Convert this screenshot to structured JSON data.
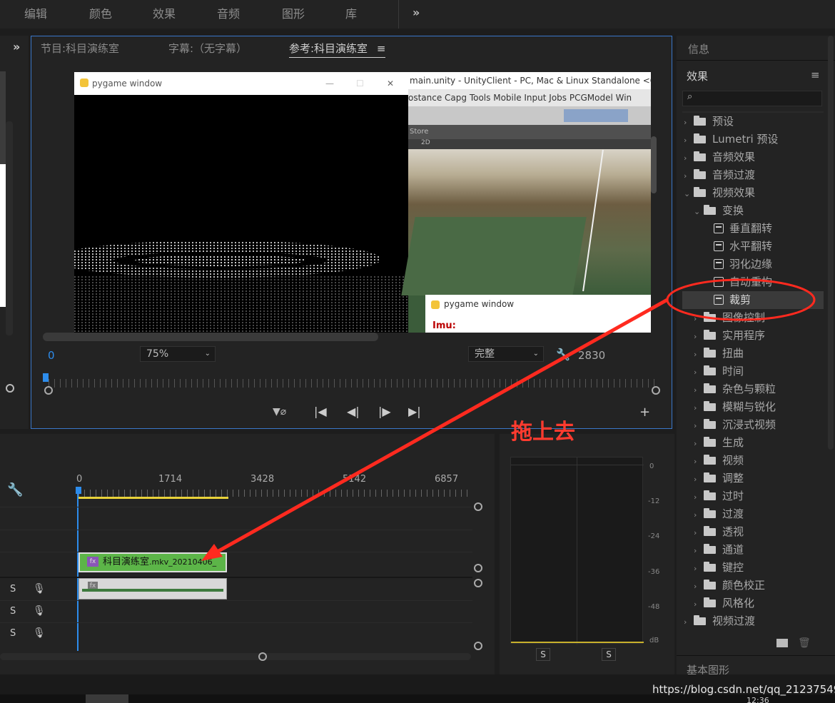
{
  "menu": {
    "items": [
      "编辑",
      "颜色",
      "效果",
      "音频",
      "图形",
      "库"
    ],
    "more": "»"
  },
  "left_panel": {
    "expand": "»"
  },
  "program_monitor": {
    "tabs": [
      "节目:科目演练室",
      "字幕:（无字幕）",
      "参考:科目演练室"
    ],
    "menu_icon": "≡",
    "video": {
      "pygame_title": "pygame window",
      "pygame_title2": "pygame window",
      "pygame_label": "Imu:",
      "unity_title": "main.unity - UnityClient - PC, Mac & Linux Standalone <OpenGL",
      "unity_menu": "ostance   Capg   Tools   Mobile Input   Jobs   PCGModel   Win",
      "unity_store": "Store",
      "unity_2d": "2D"
    },
    "timecode_left": "0",
    "zoom": "75%",
    "quality": "完整",
    "timecode_right": "2830"
  },
  "effects_panel": {
    "info_label": "信息",
    "title": "效果",
    "menu_icon": "≡",
    "search_placeholder": "",
    "tree": [
      {
        "label": "预设",
        "type": "folder-star",
        "indent": 0,
        "chevron": ">"
      },
      {
        "label": "Lumetri 预设",
        "type": "folder-star",
        "indent": 0,
        "chevron": ">"
      },
      {
        "label": "音频效果",
        "type": "folder",
        "indent": 0,
        "chevron": ">"
      },
      {
        "label": "音频过渡",
        "type": "folder",
        "indent": 0,
        "chevron": ">"
      },
      {
        "label": "视频效果",
        "type": "folder",
        "indent": 0,
        "chevron": "v"
      },
      {
        "label": "变换",
        "type": "folder",
        "indent": 1,
        "chevron": "v"
      },
      {
        "label": "垂直翻转",
        "type": "effect",
        "indent": 2,
        "chevron": ""
      },
      {
        "label": "水平翻转",
        "type": "effect",
        "indent": 2,
        "chevron": ""
      },
      {
        "label": "羽化边缘",
        "type": "effect",
        "indent": 2,
        "chevron": ""
      },
      {
        "label": "自动重构",
        "type": "effect",
        "indent": 2,
        "chevron": ""
      },
      {
        "label": "裁剪",
        "type": "effect",
        "indent": 2,
        "chevron": "",
        "selected": true
      },
      {
        "label": "图像控制",
        "type": "folder",
        "indent": 1,
        "chevron": ">"
      },
      {
        "label": "实用程序",
        "type": "folder",
        "indent": 1,
        "chevron": ">"
      },
      {
        "label": "扭曲",
        "type": "folder",
        "indent": 1,
        "chevron": ">"
      },
      {
        "label": "时间",
        "type": "folder",
        "indent": 1,
        "chevron": ">"
      },
      {
        "label": "杂色与颗粒",
        "type": "folder",
        "indent": 1,
        "chevron": ">"
      },
      {
        "label": "模糊与锐化",
        "type": "folder",
        "indent": 1,
        "chevron": ">"
      },
      {
        "label": "沉浸式视频",
        "type": "folder",
        "indent": 1,
        "chevron": ">"
      },
      {
        "label": "生成",
        "type": "folder",
        "indent": 1,
        "chevron": ">"
      },
      {
        "label": "视频",
        "type": "folder",
        "indent": 1,
        "chevron": ">"
      },
      {
        "label": "调整",
        "type": "folder",
        "indent": 1,
        "chevron": ">"
      },
      {
        "label": "过时",
        "type": "folder",
        "indent": 1,
        "chevron": ">"
      },
      {
        "label": "过渡",
        "type": "folder",
        "indent": 1,
        "chevron": ">"
      },
      {
        "label": "透视",
        "type": "folder",
        "indent": 1,
        "chevron": ">"
      },
      {
        "label": "通道",
        "type": "folder",
        "indent": 1,
        "chevron": ">"
      },
      {
        "label": "键控",
        "type": "folder",
        "indent": 1,
        "chevron": ">"
      },
      {
        "label": "颜色校正",
        "type": "folder",
        "indent": 1,
        "chevron": ">"
      },
      {
        "label": "风格化",
        "type": "folder",
        "indent": 1,
        "chevron": ">"
      },
      {
        "label": "视频过渡",
        "type": "folder",
        "indent": 0,
        "chevron": ">"
      }
    ],
    "bottom_label": "基本图形"
  },
  "timeline": {
    "ruler": [
      "0",
      "1714",
      "3428",
      "5142",
      "6857"
    ],
    "clip_label": "科目演练室",
    "clip_file": ".mkv_20210406_",
    "fx_badge": "fx",
    "track_s": [
      "S",
      "S",
      "S"
    ]
  },
  "audio_meter": {
    "scale": [
      "0",
      "-12",
      "-24",
      "-36",
      "-48",
      "dB"
    ],
    "solo": [
      "S",
      "S"
    ]
  },
  "annotation": {
    "text": "拖上去",
    "color": "#ff2a1f"
  },
  "watermark": "https://blog.csdn.net/qq_21237549",
  "clock": "12:36"
}
